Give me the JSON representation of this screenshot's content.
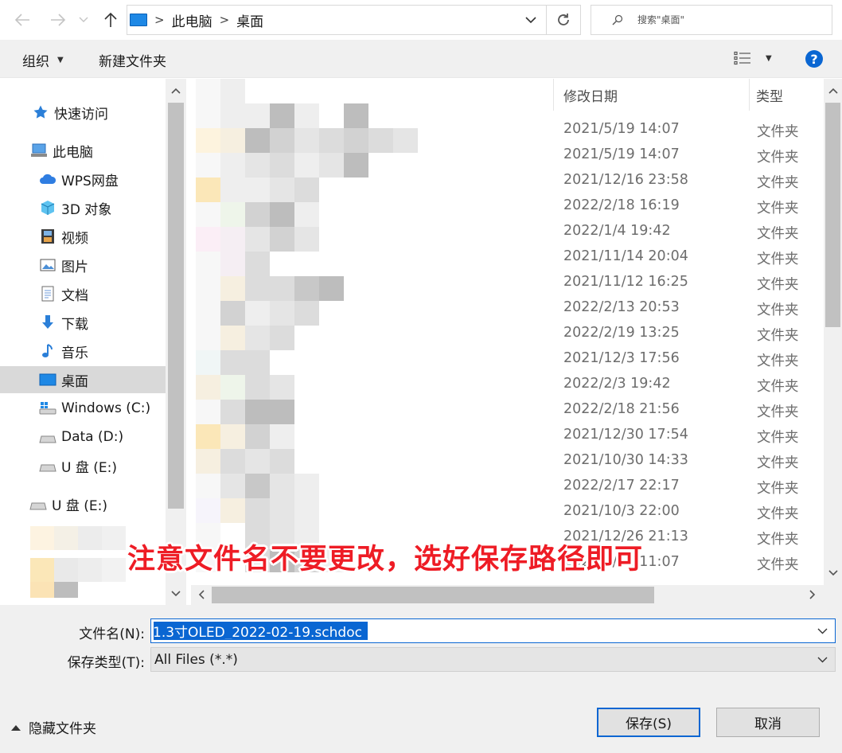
{
  "address_bar": {
    "breadcrumbs": [
      "此电脑",
      "桌面"
    ],
    "search_placeholder": "搜索\"桌面\""
  },
  "toolbar": {
    "organize_label": "组织",
    "new_folder_label": "新建文件夹",
    "help_label": "?"
  },
  "nav": {
    "items": [
      {
        "label": "快速访问",
        "icon": "star-icon"
      },
      {
        "label": "此电脑",
        "icon": "computer-icon"
      },
      {
        "label": "WPS网盘",
        "icon": "cloud-icon"
      },
      {
        "label": "3D 对象",
        "icon": "cube-icon"
      },
      {
        "label": "视频",
        "icon": "film-icon"
      },
      {
        "label": "图片",
        "icon": "picture-icon"
      },
      {
        "label": "文档",
        "icon": "document-icon"
      },
      {
        "label": "下载",
        "icon": "download-arrow-icon"
      },
      {
        "label": "音乐",
        "icon": "music-note-icon"
      },
      {
        "label": "桌面",
        "icon": "desktop-icon",
        "selected": true
      },
      {
        "label": "Windows (C:)",
        "icon": "windows-drive-icon"
      },
      {
        "label": "Data (D:)",
        "icon": "drive-icon"
      },
      {
        "label": "U 盘 (E:)",
        "icon": "usb-drive-icon"
      },
      {
        "label": "U 盘 (E:)",
        "icon": "usb-drive-icon"
      }
    ]
  },
  "file_list": {
    "columns": {
      "date": "修改日期",
      "type": "类型"
    },
    "rows": [
      {
        "date": "2021/5/19 14:07",
        "type": "文件夹"
      },
      {
        "date": "2021/5/19 14:07",
        "type": "文件夹"
      },
      {
        "date": "2021/12/16 23:58",
        "type": "文件夹"
      },
      {
        "date": "2022/2/18 16:19",
        "type": "文件夹"
      },
      {
        "date": "2022/1/4 19:42",
        "type": "文件夹"
      },
      {
        "date": "2021/11/14 20:04",
        "type": "文件夹"
      },
      {
        "date": "2021/11/12 16:25",
        "type": "文件夹"
      },
      {
        "date": "2022/2/13 20:53",
        "type": "文件夹"
      },
      {
        "date": "2022/2/19 13:25",
        "type": "文件夹"
      },
      {
        "date": "2021/12/3 17:56",
        "type": "文件夹"
      },
      {
        "date": "2022/2/3 19:42",
        "type": "文件夹"
      },
      {
        "date": "2022/2/18 21:56",
        "type": "文件夹"
      },
      {
        "date": "2021/12/30 17:54",
        "type": "文件夹"
      },
      {
        "date": "2021/10/30 14:33",
        "type": "文件夹"
      },
      {
        "date": "2022/2/17 22:17",
        "type": "文件夹"
      },
      {
        "date": "2021/10/3 22:00",
        "type": "文件夹"
      },
      {
        "date": "2021/12/26 21:13",
        "type": "文件夹"
      },
      {
        "date": "2022/1/12 11:07",
        "type": "文件夹"
      }
    ]
  },
  "caption": "注意文件名不要更改，选好保存路径即可",
  "form": {
    "filename_label": "文件名(N):",
    "filename_value": "1.3寸OLED_2022-02-19.schdoc",
    "filetype_label": "保存类型(T):",
    "filetype_value": "All Files (*.*)"
  },
  "footer": {
    "hide_folders_label": "隐藏文件夹",
    "save_label": "保存(S)",
    "cancel_label": "取消"
  },
  "colors": {
    "accent": "#0a66d2",
    "caption": "#ee1c25",
    "selected_nav": "#d9d9d9"
  }
}
